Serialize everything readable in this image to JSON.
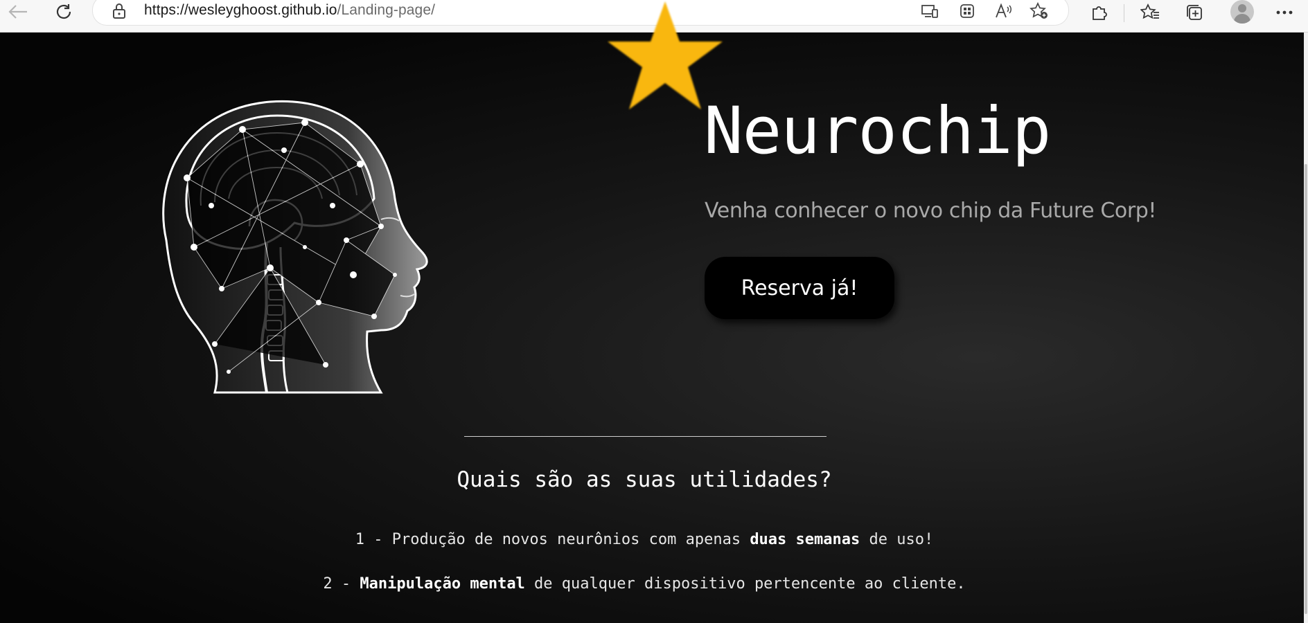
{
  "browser": {
    "url_domain": "https://wesleyghoost.github.io",
    "url_path": "/Landing-page/",
    "icons": [
      "back-icon",
      "refresh-icon",
      "lock-icon",
      "app-available-icon",
      "grid-icon",
      "read-aloud-icon",
      "favorite-add-icon",
      "extensions-icon",
      "favorites-icon",
      "collections-icon",
      "profile-avatar",
      "more-icon"
    ]
  },
  "hero": {
    "title": "Neurochip",
    "subtitle": "Venha conhecer o novo chip da Future Corp!",
    "cta_label": "Reserva já!",
    "star_color": "#F9B70F"
  },
  "section": {
    "title": "Quais são as suas utilidades?",
    "features": [
      {
        "prefix": "1 - Produção de novos neurônios com apenas ",
        "bold": "duas semanas",
        "suffix": " de uso!"
      },
      {
        "prefix": "2 - ",
        "bold": "Manipulação mental",
        "suffix": " de qualquer dispositivo pertencente ao cliente."
      }
    ]
  }
}
